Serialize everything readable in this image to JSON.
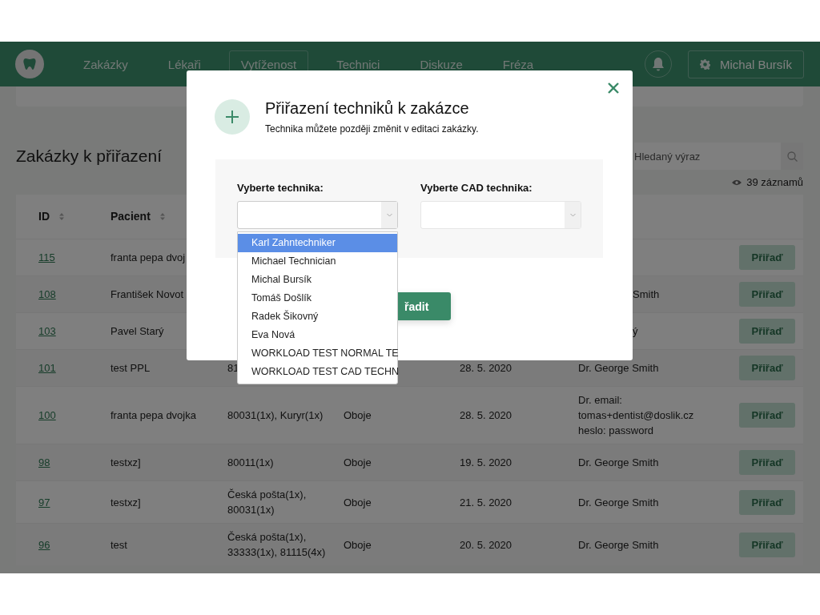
{
  "nav": {
    "items": [
      {
        "label": "Zakázky",
        "selected": false
      },
      {
        "label": "Lékaři",
        "selected": false
      },
      {
        "label": "Vytíženost",
        "selected": true
      },
      {
        "label": "Technici",
        "selected": false
      },
      {
        "label": "Diskuze",
        "selected": false
      },
      {
        "label": "Fréza",
        "selected": false
      }
    ],
    "user": "Michal Bursík"
  },
  "page": {
    "title": "Zakázky k přiřazení",
    "search": {
      "placeholder": "Hledaný výraz"
    },
    "records": "39 záznamů",
    "table": {
      "columns": [
        {
          "label": "ID",
          "sortable": true
        },
        {
          "label": "Pacient",
          "sortable": true
        }
      ],
      "rows": [
        {
          "id": "115",
          "patient": "franta pepa dvoj",
          "action": "Přiřaď"
        },
        {
          "id": "108",
          "patient": "František Novot",
          "doctor_tail": "Smith",
          "action": "Přiřaď"
        },
        {
          "id": "103",
          "patient": "Pavel Starý",
          "doctor_tail": "ý",
          "action": "Přiřaď"
        },
        {
          "id": "101",
          "patient": "test PPL",
          "items": "81",
          "date": "28. 5. 2020",
          "doctor": "Dr. George Smith",
          "action": "Přiřaď"
        },
        {
          "id": "100",
          "patient": "franta pepa dvojka",
          "items": "80031(1x), Kuryr(1x)",
          "type": "Oboje",
          "date": "28. 5. 2020",
          "doctor": "Dr. email: tomas+dentist@doslik.cz heslo: password",
          "action": "Přiřaď"
        },
        {
          "id": "98",
          "patient": "testxz]",
          "items": "80011(1x)",
          "type": "Oboje",
          "date": "19. 5. 2020",
          "doctor": "Dr. George Smith",
          "action": "Přiřaď"
        },
        {
          "id": "97",
          "patient": "testxz]",
          "items": "Česká pošta(1x), 80031(1x)",
          "type": "Oboje",
          "date": "21. 5. 2020",
          "doctor": "Dr. George Smith",
          "action": "Přiřaď"
        },
        {
          "id": "96",
          "patient": "test",
          "items": "Česká pošta(1x), 33333(1x), 81115(4x)",
          "type": "Oboje",
          "date": "20. 5. 2020",
          "doctor": "Dr. George Smith",
          "action": "Přiřaď"
        }
      ]
    }
  },
  "modal": {
    "title": "Přiřazení techniků k zakázce",
    "subtitle": "Technika můžete později změnit v editaci zakázky.",
    "fields": [
      {
        "label": "Vyberte technika:",
        "open": true,
        "options": [
          {
            "label": "Karl Zahntechniker",
            "selected": true
          },
          {
            "label": "Michael Technician",
            "selected": false
          },
          {
            "label": "Michal Bursík",
            "selected": false
          },
          {
            "label": "Tomáš Došlík",
            "selected": false
          },
          {
            "label": "Radek Šikovný",
            "selected": false
          },
          {
            "label": "Eva Nová",
            "selected": false
          },
          {
            "label": "WORKLOAD TEST NORMAL TE",
            "selected": false
          },
          {
            "label": "WORKLOAD TEST CAD TECHN",
            "selected": false
          }
        ]
      },
      {
        "label": "Vyberte CAD technika:",
        "open": false
      }
    ],
    "submit": "řadit"
  }
}
